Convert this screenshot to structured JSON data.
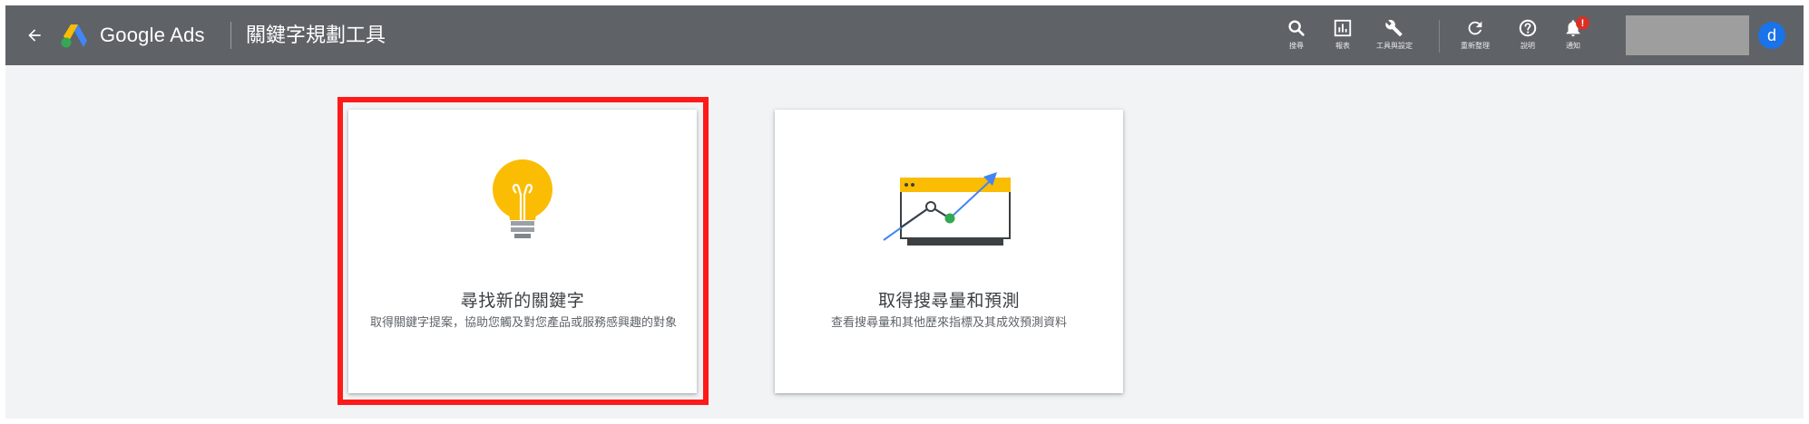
{
  "header": {
    "product_name": "Google Ads",
    "tool_title": "關鍵字規劃工具",
    "actions": [
      {
        "label": "搜尋",
        "icon": "search-icon"
      },
      {
        "label": "報表",
        "icon": "reports-icon"
      },
      {
        "label": "工具與設定",
        "icon": "wrench-icon"
      },
      {
        "label": "重新整理",
        "icon": "refresh-icon"
      },
      {
        "label": "說明",
        "icon": "help-icon"
      },
      {
        "label": "通知",
        "icon": "bell-icon"
      }
    ],
    "notification_badge": "!",
    "avatar_letter": "d"
  },
  "cards": [
    {
      "title": "尋找新的關鍵字",
      "description": "取得關鍵字提案，協助您觸及對您產品或服務感興趣的對象",
      "icon": "lightbulb-icon",
      "highlighted": true
    },
    {
      "title": "取得搜尋量和預測",
      "description": "查看搜尋量和其他歷來指標及其成效預測資料",
      "icon": "trend-chart-icon",
      "highlighted": false
    }
  ],
  "colors": {
    "header_bg": "#5f6368",
    "page_bg": "#f1f3f4",
    "highlight": "#ff1a1a",
    "accent_blue": "#1a73e8",
    "bulb_yellow": "#fbbc04",
    "alert_red": "#d93025"
  }
}
